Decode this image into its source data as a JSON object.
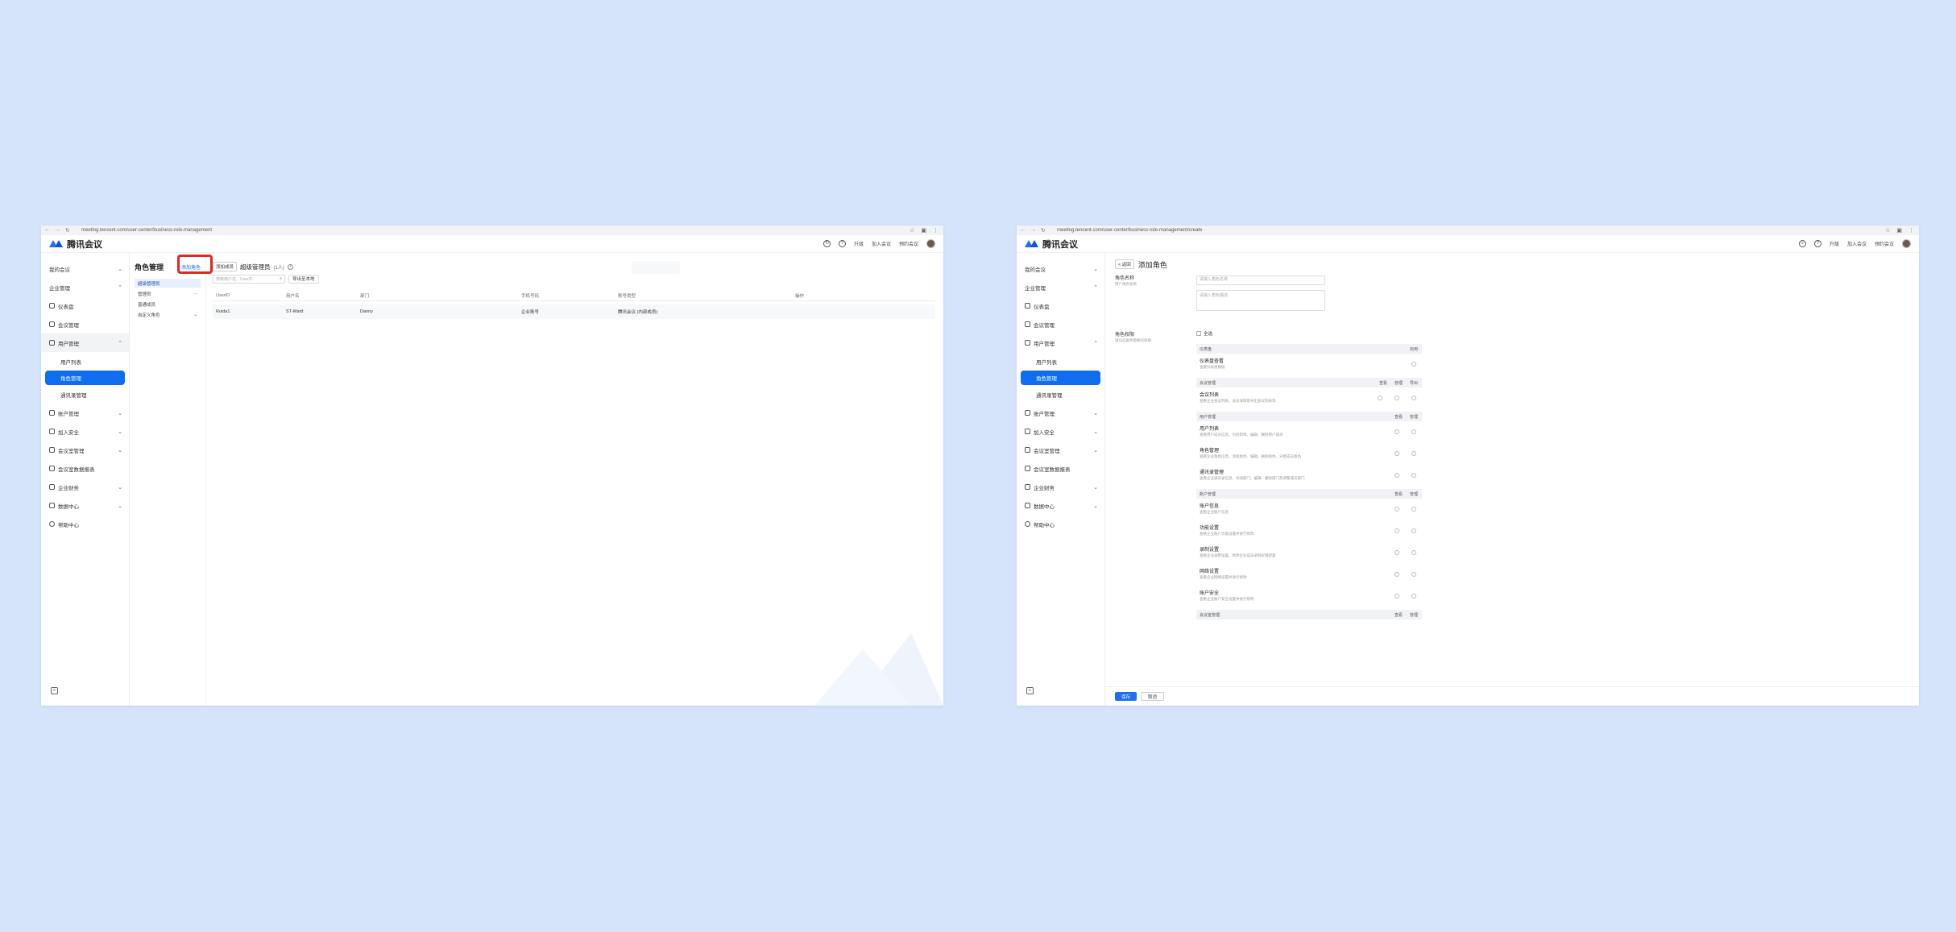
{
  "left_window": {
    "browser": {
      "url": "meeting.tencent.com/user-center/business-role-management"
    },
    "header": {
      "app_name": "腾讯会议",
      "links": [
        "升级",
        "加入会议",
        "预约会议"
      ]
    },
    "sidebar": {
      "items": [
        {
          "label": "我的会议",
          "chevron": "⌄"
        },
        {
          "label": "企业管理",
          "chevron": "⌃"
        },
        {
          "label": "仪表盘"
        },
        {
          "label": "会议管理"
        },
        {
          "label": "用户管理",
          "chevron": "⌃"
        },
        {
          "label": "用户列表"
        },
        {
          "label": "角色管理"
        },
        {
          "label": "通讯录管理"
        },
        {
          "label": "账户管理",
          "chevron": "⌄"
        },
        {
          "label": "加入安全",
          "chevron": "⌄"
        },
        {
          "label": "会议室管理",
          "chevron": "⌄"
        },
        {
          "label": "会议室数据报表"
        },
        {
          "label": "企业财务",
          "chevron": "⌄"
        },
        {
          "label": "数据中心",
          "chevron": "⌄"
        },
        {
          "label": "帮助中心"
        }
      ]
    },
    "role_panel": {
      "title": "角色管理",
      "add_label": "添加角色",
      "roles": [
        {
          "label": "超级管理员",
          "extra": ""
        },
        {
          "label": "管理员",
          "extra": "···"
        },
        {
          "label": "普通成员",
          "extra": ""
        },
        {
          "label": "自定义角色",
          "extra": "⌄"
        }
      ]
    },
    "detail": {
      "tag_label": "添加成员",
      "title": "超级管理员",
      "count": "(1人)",
      "info_icon": "i",
      "search_placeholder": "搜索用户名、UserID",
      "filter_label": "导出至本地",
      "columns": [
        "UserID",
        "用户名",
        "部门",
        "手机号码",
        "账号类型",
        "操作"
      ],
      "rows": [
        [
          "Ruida1",
          "ST-Ward",
          "Danny",
          "企业账号",
          "腾讯会议 (内部成员)",
          ""
        ]
      ]
    }
  },
  "right_window": {
    "browser": {
      "url": "meeting.tencent.com/user-center/business-role-management/create"
    },
    "header": {
      "app_name": "腾讯会议",
      "links": [
        "升级",
        "加入会议",
        "预约会议"
      ]
    },
    "sidebar": {
      "items": [
        {
          "label": "我的会议",
          "chevron": "⌄"
        },
        {
          "label": "企业管理",
          "chevron": "⌃"
        },
        {
          "label": "仪表盘"
        },
        {
          "label": "会议管理"
        },
        {
          "label": "用户管理",
          "chevron": "⌃"
        },
        {
          "label": "用户列表"
        },
        {
          "label": "角色管理"
        },
        {
          "label": "通讯录管理"
        },
        {
          "label": "账户管理",
          "chevron": "⌄"
        },
        {
          "label": "加入安全",
          "chevron": "⌄"
        },
        {
          "label": "会议室管理",
          "chevron": "⌄"
        },
        {
          "label": "会议室数据报表"
        },
        {
          "label": "企业财务",
          "chevron": "⌄"
        },
        {
          "label": "数据中心",
          "chevron": "⌄"
        },
        {
          "label": "帮助中心"
        }
      ]
    },
    "form": {
      "back_label": "< 返回",
      "title": "添加角色",
      "name_label": "角色名称",
      "name_hint": "用户角色名称",
      "name_placeholder": "请输入角色名称",
      "desc_placeholder": "请输入角色描述",
      "perm_label": "角色权限",
      "perm_hint": "请勾选角色需要的权限",
      "select_all": "全选",
      "sections": [
        {
          "title": "仪表盘",
          "cols": [
            "启用"
          ],
          "rows": [
            {
              "name": "仪表盘查看",
              "desc": "查看仪表盘数据",
              "n": 1
            }
          ]
        },
        {
          "title": "会议管理",
          "cols": [
            "查看",
            "管理",
            "导出"
          ],
          "rows": [
            {
              "name": "会议列表",
              "desc": "查看企业会议列表，会议详情及导出会议列表等",
              "n": 3
            }
          ]
        },
        {
          "title": "用户管理",
          "cols": [
            "查看",
            "管理"
          ],
          "rows": [
            {
              "name": "用户列表",
              "desc": "查看用户成员信息，包括新增、编辑、删除用户成员",
              "n": 2
            },
            {
              "name": "角色管理",
              "desc": "查看企业角色信息，添加角色、编辑、删除角色、分配成员角色",
              "n": 2
            },
            {
              "name": "通讯录管理",
              "desc": "查看企业通讯录信息，添加部门、编辑、删除部门及调整成员部门",
              "n": 2
            }
          ]
        },
        {
          "title": "账户管理",
          "cols": [
            "查看",
            "管理"
          ],
          "rows": [
            {
              "name": "账户信息",
              "desc": "查看企业账户信息",
              "n": 2
            },
            {
              "name": "功能设置",
              "desc": "查看企业账户功能设置并进行修改",
              "n": 2
            },
            {
              "name": "录制设置",
              "desc": "查看企业录制设置，修改企业成员录制权限配置",
              "n": 2
            },
            {
              "name": "网络设置",
              "desc": "查看企业网络设置并进行修改",
              "n": 2
            },
            {
              "name": "账户安全",
              "desc": "查看企业账户安全设置并进行修改",
              "n": 2
            }
          ]
        },
        {
          "title": "会议室管理",
          "cols": [
            "查看",
            "管理"
          ],
          "rows": []
        }
      ],
      "save_label": "保存",
      "cancel_label": "取消"
    }
  },
  "colors": {
    "accent": "#1f6ef5",
    "background": "#d6e4fb",
    "highlight": "#e5271f"
  }
}
